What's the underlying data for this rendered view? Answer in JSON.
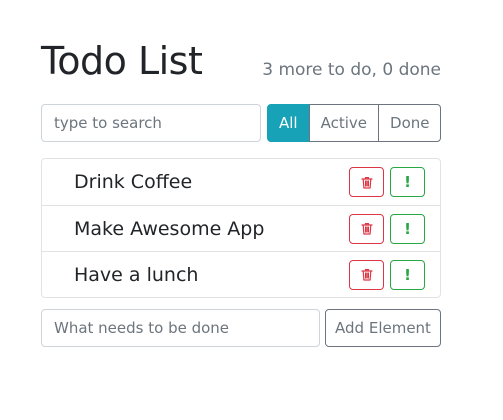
{
  "header": {
    "title": "Todo List",
    "subtitle": "3 more to do, 0 done"
  },
  "search": {
    "placeholder": "type to search"
  },
  "filters": [
    {
      "label": "All",
      "active": true
    },
    {
      "label": "Active",
      "active": false
    },
    {
      "label": "Done",
      "active": false
    }
  ],
  "items": [
    {
      "label": "Drink Coffee",
      "delete_icon": "trash-icon",
      "important_icon": "exclamation-icon"
    },
    {
      "label": "Make Awesome App",
      "delete_icon": "trash-icon",
      "important_icon": "exclamation-icon"
    },
    {
      "label": "Have a lunch",
      "delete_icon": "trash-icon",
      "important_icon": "exclamation-icon"
    }
  ],
  "important_glyph": "!",
  "add_form": {
    "placeholder": "What needs to be done",
    "button_label": "Add Element"
  },
  "colors": {
    "accent": "#17a2b8",
    "danger": "#dc3545",
    "success": "#28a745",
    "muted": "#6c757d"
  }
}
